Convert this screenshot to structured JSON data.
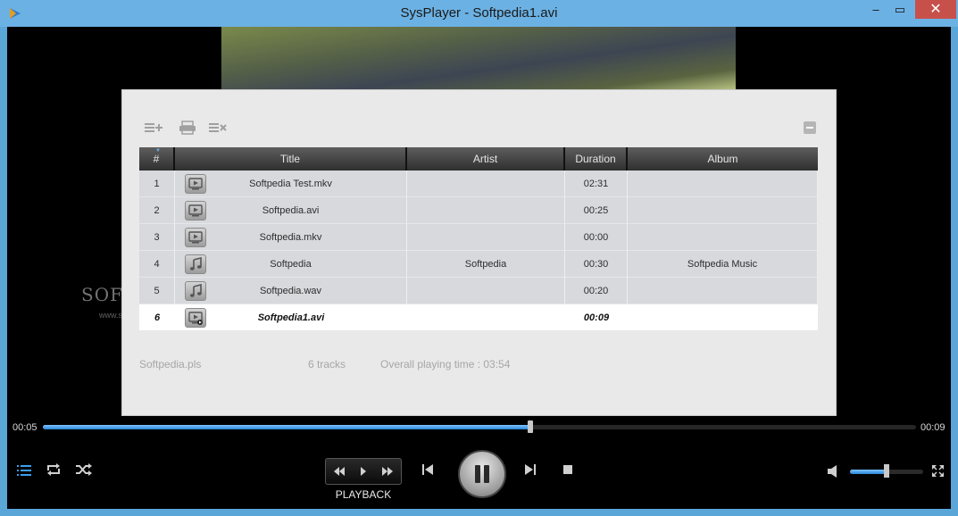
{
  "window": {
    "title": "SysPlayer - Softpedia1.avi",
    "min": "–",
    "max": "▭",
    "close": "✕"
  },
  "playlist": {
    "columns": {
      "num": "#",
      "title": "Title",
      "artist": "Artist",
      "duration": "Duration",
      "album": "Album"
    },
    "tracks": [
      {
        "num": "1",
        "icon": "video-file-icon",
        "title": "Softpedia Test.mkv",
        "artist": "",
        "duration": "02:31",
        "album": ""
      },
      {
        "num": "2",
        "icon": "video-file-icon",
        "title": "Softpedia.avi",
        "artist": "",
        "duration": "00:25",
        "album": ""
      },
      {
        "num": "3",
        "icon": "video-file-icon",
        "title": "Softpedia.mkv",
        "artist": "",
        "duration": "00:00",
        "album": ""
      },
      {
        "num": "4",
        "icon": "music-note-icon",
        "title": "Softpedia",
        "artist": "Softpedia",
        "duration": "00:30",
        "album": "Softpedia Music"
      },
      {
        "num": "5",
        "icon": "music-note-icon",
        "title": "Softpedia.wav",
        "artist": "",
        "duration": "00:20",
        "album": ""
      },
      {
        "num": "6",
        "icon": "video-playing-icon",
        "title": "Softpedia1.avi",
        "artist": "",
        "duration": "00:09",
        "album": ""
      }
    ],
    "current_index": 5,
    "footer": {
      "file": "Softpedia.pls",
      "tracks": "6 tracks",
      "total_time": "Overall playing time : 03:54"
    }
  },
  "watermark": {
    "text": "SOFTPEDIA",
    "sub": "www.softpedia.com"
  },
  "playback": {
    "current_time": "00:05",
    "total_time": "00:09",
    "progress": 0.558,
    "label": "PLAYBACK",
    "volume": 0.5
  },
  "colors": {
    "accent": "#2a86d6",
    "titlebar": "#6cb1e3",
    "close": "#c7504a"
  }
}
